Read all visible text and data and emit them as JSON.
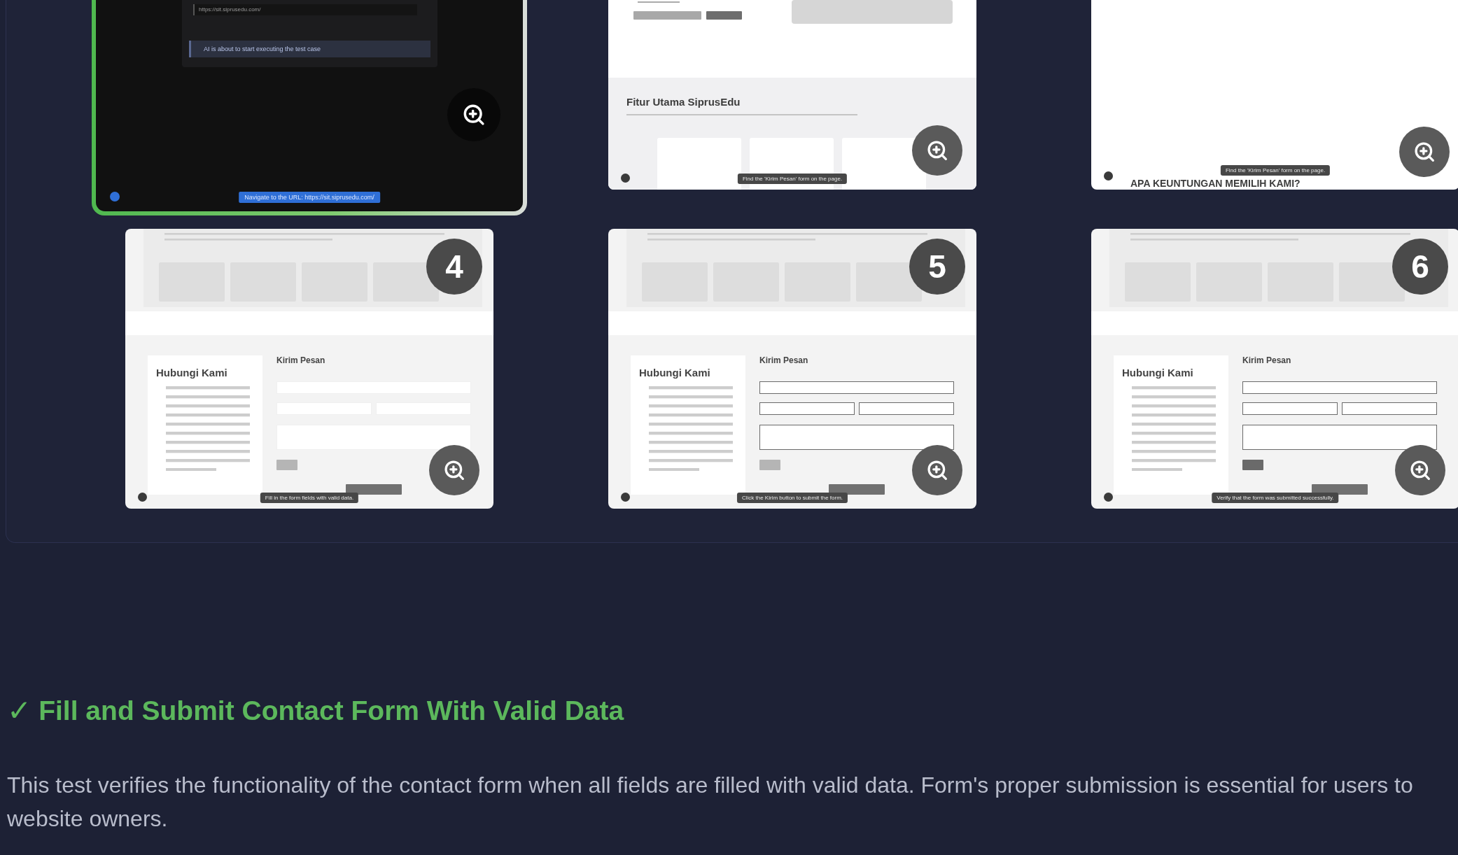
{
  "steps": [
    {
      "kind": "start",
      "selected": true,
      "url_value": "https://sit.siprusedu.com/",
      "notice": "AI is about to start executing the test case",
      "caption": "Navigate to the URL: https://sit.siprusedu.com/"
    },
    {
      "kind": "features",
      "selected": false,
      "section_title": "Fitur Utama SiprusEdu",
      "caption": "Find the 'Kirim Pesan' form on the page."
    },
    {
      "kind": "blank",
      "selected": false,
      "section_title": "APA KEUNTUNGAN MEMILIH KAMI?",
      "caption": "Find the 'Kirim Pesan' form on the page."
    },
    {
      "kind": "contact",
      "selected": false,
      "badge": "4",
      "contact_title": "Hubungi Kami",
      "form_title": "Kirim Pesan",
      "filled": false,
      "submit_enabled": false,
      "caption": "Fill in the form fields with valid data."
    },
    {
      "kind": "contact",
      "selected": false,
      "badge": "5",
      "contact_title": "Hubungi Kami",
      "form_title": "Kirim Pesan",
      "filled": true,
      "submit_enabled": false,
      "caption": "Click the Kirim button to submit the form."
    },
    {
      "kind": "contact",
      "selected": false,
      "badge": "6",
      "contact_title": "Hubungi Kami",
      "form_title": "Kirim Pesan",
      "filled": true,
      "submit_enabled": true,
      "caption": "Verify that the form was submitted successfully."
    }
  ],
  "test": {
    "check": "✓",
    "passed": true,
    "title": "Fill and Submit Contact Form With Valid Data",
    "description_lines": [
      "This test verifies the functionality of the contact form when all fields are filled with valid data. Form's proper submission is essential for users to",
      "website owners."
    ]
  }
}
